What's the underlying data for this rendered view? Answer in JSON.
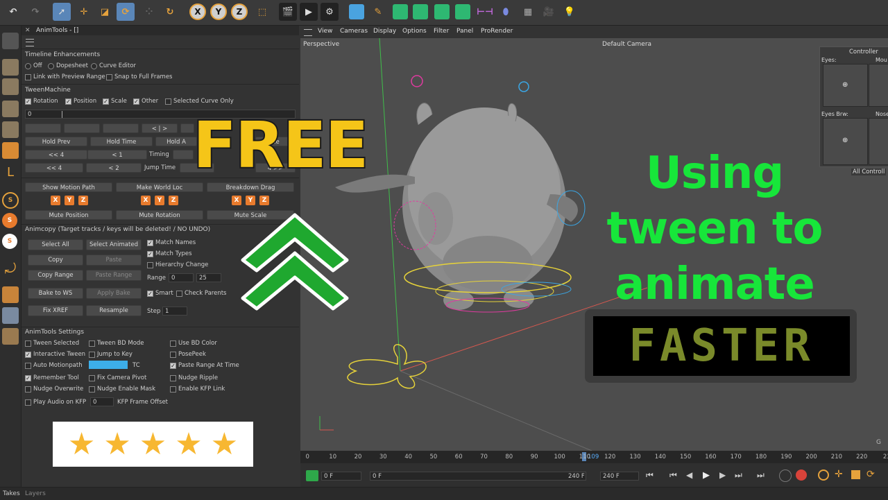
{
  "panel": {
    "title": "AnimTools - []",
    "sections": {
      "timeline": "Timeline Enhancements",
      "tweenmachine": "TweenMachine",
      "animcopy": "Animcopy (Target tracks / keys will be deleted! / NO UNDO)",
      "settings": "AnimTools Settings"
    },
    "timeline_modes": [
      "Off",
      "Dopesheet",
      "Curve Editor"
    ],
    "timeline_opts": [
      "Link with Preview Range",
      "Snap to Full Frames"
    ],
    "tween_checks": [
      "Rotation",
      "Position",
      "Scale",
      "Other",
      "Selected Curve Only"
    ],
    "tween_value": "0",
    "btn_center": "< | >",
    "hold_prev": "Hold Prev",
    "hold_time": "Hold Time",
    "hold_a": "Hold A",
    "key_prev4": "<< 4",
    "key_prev1": "< 1",
    "timing": "Timing",
    "jump_prev4": "<< 4",
    "jump_prev2": "< 2",
    "jump_time": "Jump Time",
    "jump_next": "4 >>",
    "partial_ne": "Ne",
    "motion": {
      "show_motion_path": "Show Motion Path",
      "make_world_loc": "Make World Loc",
      "breakdown_drag": "Breakdown Drag",
      "xyz": [
        "X",
        "Y",
        "Z"
      ],
      "mute_position": "Mute Position",
      "mute_rotation": "Mute Rotation",
      "mute_scale": "Mute Scale"
    },
    "animcopy": {
      "select_all": "Select All",
      "select_animated": "Select Animated",
      "copy": "Copy",
      "paste": "Paste",
      "copy_range": "Copy Range",
      "paste_range": "Paste Range",
      "bake_ws": "Bake to WS",
      "apply_bake": "Apply Bake",
      "fix_xref": "Fix XREF",
      "resample": "Resample",
      "match_names": "Match Names",
      "match_types": "Match Types",
      "hierarchy_change": "Hierarchy Change",
      "range_label": "Range",
      "range_from": "0",
      "range_to": "25",
      "smart": "Smart",
      "check_parents": "Check Parents",
      "step_label": "Step",
      "step": "1"
    },
    "settings": {
      "col1": [
        "Tween Selected",
        "Interactive Tween",
        "Auto Motionpath",
        "Remember Tool",
        "Nudge Overwrite",
        "Play Audio on KFP"
      ],
      "col2": [
        "Tween BD Mode",
        "Jump to Key",
        "TC",
        "Fix Camera Pivot",
        "Nudge Enable Mask",
        "KFP Frame Offset"
      ],
      "col3": [
        "Use BD Color",
        "PosePeek",
        "Paste Range At Time",
        "Nudge Ripple",
        "Enable KFP Link"
      ],
      "kfp_offset": "0",
      "color_swatch": "#3daee9"
    }
  },
  "viewport": {
    "menu": [
      "View",
      "Cameras",
      "Display",
      "Options",
      "Filter",
      "Panel",
      "ProRender"
    ],
    "label": "Perspective",
    "camera": "Default Camera",
    "controller": {
      "title": "Controller",
      "eyes": "Eyes:",
      "mouth": "Mou",
      "eyes_brw": "Eyes Brw:",
      "nose": "Nose",
      "all": "All Controll"
    },
    "corner": "G"
  },
  "overlay": {
    "free": "FREE",
    "using": [
      "Using",
      "tween to",
      "animate"
    ],
    "faster": "FASTER",
    "star_count": 5,
    "colors": {
      "free": "#f5c518",
      "using": "#17e63a",
      "chevron": "#1fa82f",
      "star": "#f7b731"
    }
  },
  "timeline": {
    "ticks": [
      "0",
      "10",
      "20",
      "30",
      "40",
      "50",
      "60",
      "70",
      "80",
      "90",
      "100",
      "110",
      "120",
      "130",
      "140",
      "150",
      "160",
      "170",
      "180",
      "190",
      "200",
      "210",
      "220",
      "23"
    ],
    "current": "109",
    "start": "0 F",
    "preview_start": "0 F",
    "end": "240 F",
    "end2": "240 F"
  },
  "bottom": {
    "tabs": [
      "Takes",
      "Layers"
    ]
  }
}
